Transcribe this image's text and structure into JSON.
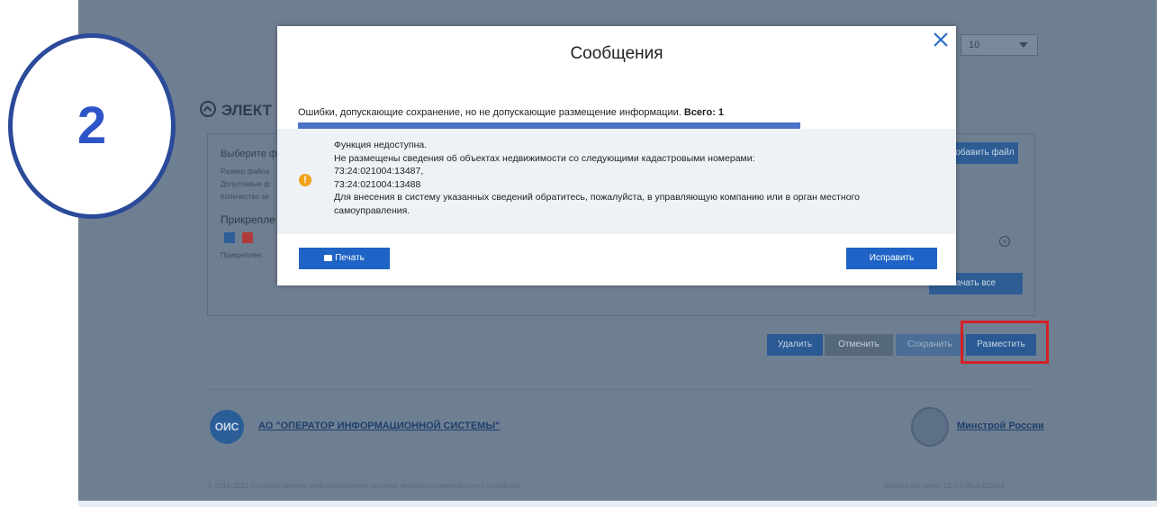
{
  "step_number": "2",
  "background_page": {
    "select_value": "10",
    "section_title": "ЭЛЕКТ",
    "panel": {
      "select_file_label": "Выберите ф",
      "file_size_label": "Размер файла",
      "allowed_label": "Допустимые ф",
      "count_label": "Количество за",
      "attached_heading": "Прикрепле",
      "attached_by_label": "Прикреплен:",
      "add_file_button": "обавить файл",
      "download_all_button": "ачать все"
    },
    "buttons": {
      "delete": "Удалить",
      "cancel": "Отменить",
      "save": "Сохранить",
      "place": "Разместить"
    },
    "footer": {
      "ois_logo": "ОИС",
      "ois_link": "АО \"ОПЕРАТОР ИНФОРМАЦИОННОЙ СИСТЕМЫ\"",
      "ministry_link": "Минстрой России",
      "copyright": "© 2016-2021 Государственная информационная система жилищно-коммунального хозяйства",
      "version": "Версия системы: 13.3.4.0build31343"
    }
  },
  "modal": {
    "title": "Сообщения",
    "error_heading": "Ошибки, допускающие сохранение, но не допускающие размещение информации.",
    "error_total": "Всего: 1",
    "message_lines": [
      "Функция недоступна.",
      "Не размещены сведения об объектах недвижимости со следующими кадастровыми номерами:",
      "73:24:021004:13487,",
      "73:24:021004:13488",
      "Для внесения в систему указанных сведений обратитесь, пожалуйста, в управляющую компанию или в орган местного",
      "самоуправления."
    ],
    "print_button": "Печать",
    "fix_button": "Исправить"
  },
  "colors": {
    "overlay": "#6f7f92",
    "primary_button": "#1e63c5",
    "warning": "#f0a21b",
    "highlight_frame": "#d42027",
    "step_border": "#2b4a99",
    "step_digit": "#2d55c7"
  },
  "icons": {
    "close": "close-icon",
    "warning": "warning-icon",
    "printer": "printer-icon",
    "collapse": "chevron-up-circle-icon",
    "remove": "remove-circle-icon"
  }
}
